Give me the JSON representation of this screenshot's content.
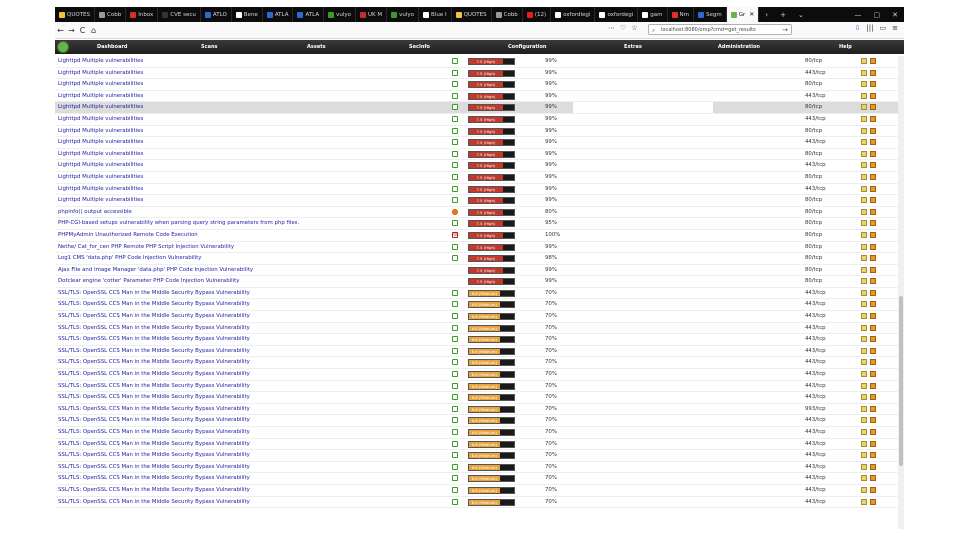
{
  "browser": {
    "tabs": [
      {
        "label": "QUOTES",
        "icon": "quote-icon",
        "color": "#f0c040"
      },
      {
        "label": "Cobb",
        "icon": "loading-icon",
        "color": "#999999"
      },
      {
        "label": "Inbox",
        "icon": "mail-icon",
        "color": "#d93025"
      },
      {
        "label": "CVE secu",
        "icon": "cve-icon",
        "color": "#333333"
      },
      {
        "label": "ATLO",
        "icon": "atl-icon",
        "color": "#2a6bd1"
      },
      {
        "label": "Bene",
        "icon": "doc-icon",
        "color": "#ffffff"
      },
      {
        "label": "ATLA",
        "icon": "atl-icon",
        "color": "#2a6bd1"
      },
      {
        "label": "ATLA",
        "icon": "atl-icon",
        "color": "#2a6bd1"
      },
      {
        "label": "vulyo",
        "icon": "globe-icon",
        "color": "#3a9a2a"
      },
      {
        "label": "UK M",
        "icon": "globe-icon",
        "color": "#c03030"
      },
      {
        "label": "vulyo",
        "icon": "globe-icon",
        "color": "#3a9a2a"
      },
      {
        "label": "Blue I",
        "icon": "shield-icon",
        "color": "#ffffff"
      },
      {
        "label": "QUOTES",
        "icon": "quote-icon",
        "color": "#f0c040"
      },
      {
        "label": "Cobb",
        "icon": "loading-icon",
        "color": "#999999"
      },
      {
        "label": "(12)",
        "icon": "video-icon",
        "color": "#e02020"
      },
      {
        "label": "oxfordlegi",
        "icon": "doc-icon",
        "color": "#ffffff"
      },
      {
        "label": "oxfordegi",
        "icon": "doc-icon",
        "color": "#ffffff"
      },
      {
        "label": "gam",
        "icon": "g-icon",
        "color": "#ffffff"
      },
      {
        "label": "Nm",
        "icon": "news-icon",
        "color": "#e03030"
      },
      {
        "label": "Segm",
        "icon": "s-icon",
        "color": "#2a6bd1"
      },
      {
        "label": "Gr",
        "icon": "leaf-icon",
        "color": "#6ab04c"
      }
    ],
    "url": "localhost:8080/omp?cmd=get_results",
    "window_controls": [
      "—",
      "▢",
      "✕"
    ],
    "nav": {
      "back": "←",
      "forward": "→",
      "reload": "C",
      "home": "⌂"
    },
    "toolbar_icons": [
      "⋯",
      "♡",
      "☆"
    ],
    "right_icons": [
      "⇩",
      "|||",
      "▭",
      "≡"
    ]
  },
  "app_nav": {
    "menus": [
      "Dashboard",
      "Scans",
      "Assets",
      "SecInfo",
      "Configuration",
      "Extras",
      "Administration",
      "Help"
    ]
  },
  "colors": {
    "high": "#c0392b",
    "medium": "#e8a33c",
    "link": "#1a1aa6"
  },
  "results": [
    {
      "name": "Lighttpd Multiple vulnerabilities",
      "status": "green",
      "severity": "7.5 (High)",
      "level": "high",
      "qod": "99%",
      "port": "80/tcp",
      "hl": false
    },
    {
      "name": "Lighttpd Multiple vulnerabilities",
      "status": "green",
      "severity": "7.5 (High)",
      "level": "high",
      "qod": "99%",
      "port": "443/tcp",
      "hl": false
    },
    {
      "name": "Lighttpd Multiple vulnerabilities",
      "status": "green",
      "severity": "7.5 (High)",
      "level": "high",
      "qod": "99%",
      "port": "80/tcp",
      "hl": false
    },
    {
      "name": "Lighttpd Multiple vulnerabilities",
      "status": "green",
      "severity": "7.5 (High)",
      "level": "high",
      "qod": "99%",
      "port": "443/tcp",
      "hl": false
    },
    {
      "name": "Lighttpd Multiple vulnerabilities",
      "status": "green",
      "severity": "7.5 (High)",
      "level": "high",
      "qod": "99%",
      "port": "80/tcp",
      "hl": true
    },
    {
      "name": "Lighttpd Multiple vulnerabilities",
      "status": "green",
      "severity": "7.5 (High)",
      "level": "high",
      "qod": "99%",
      "port": "443/tcp",
      "hl": false
    },
    {
      "name": "Lighttpd Multiple vulnerabilities",
      "status": "green",
      "severity": "7.5 (High)",
      "level": "high",
      "qod": "99%",
      "port": "80/tcp",
      "hl": false
    },
    {
      "name": "Lighttpd Multiple vulnerabilities",
      "status": "green",
      "severity": "7.5 (High)",
      "level": "high",
      "qod": "99%",
      "port": "443/tcp",
      "hl": false
    },
    {
      "name": "Lighttpd Multiple vulnerabilities",
      "status": "green",
      "severity": "7.5 (High)",
      "level": "high",
      "qod": "99%",
      "port": "80/tcp",
      "hl": false
    },
    {
      "name": "Lighttpd Multiple vulnerabilities",
      "status": "green",
      "severity": "7.5 (High)",
      "level": "high",
      "qod": "99%",
      "port": "443/tcp",
      "hl": false
    },
    {
      "name": "Lighttpd Multiple vulnerabilities",
      "status": "green",
      "severity": "7.5 (High)",
      "level": "high",
      "qod": "99%",
      "port": "80/tcp",
      "hl": false
    },
    {
      "name": "Lighttpd Multiple vulnerabilities",
      "status": "green",
      "severity": "7.5 (High)",
      "level": "high",
      "qod": "99%",
      "port": "443/tcp",
      "hl": false
    },
    {
      "name": "Lighttpd Multiple vulnerabilities",
      "status": "green",
      "severity": "7.5 (High)",
      "level": "high",
      "qod": "99%",
      "port": "80/tcp",
      "hl": false
    },
    {
      "name": "phpinfo() output accessible",
      "status": "orange",
      "severity": "7.5 (High)",
      "level": "high",
      "qod": "80%",
      "port": "80/tcp",
      "hl": false
    },
    {
      "name": "PHP-CGI-based setups vulnerability when parsing query string parameters from php files.",
      "status": "green",
      "severity": "7.5 (High)",
      "level": "high",
      "qod": "95%",
      "port": "80/tcp",
      "hl": false
    },
    {
      "name": "PHPMyAdmin Unauthorized Remote Code Execution",
      "status": "red",
      "severity": "7.5 (High)",
      "level": "high",
      "qod": "100%",
      "port": "80/tcp",
      "hl": false
    },
    {
      "name": "Nethe/ Cat_for_cen PHP Remote PHP Script Injection Vulnerability",
      "status": "green",
      "severity": "7.5 (High)",
      "level": "high",
      "qod": "99%",
      "port": "80/tcp",
      "hl": false
    },
    {
      "name": "Log1 CMS 'data.php' PHP Code Injection Vulnerability",
      "status": "green",
      "severity": "7.5 (High)",
      "level": "high",
      "qod": "98%",
      "port": "80/tcp",
      "hl": false
    },
    {
      "name": "Ajax File and Image Manager 'data.php' PHP Code Injection Vulnerability",
      "status": "none",
      "severity": "7.5 (High)",
      "level": "high",
      "qod": "99%",
      "port": "80/tcp",
      "hl": false
    },
    {
      "name": "Dotclear engine 'cotter' Parameter PHP Code Injection Vulnerability",
      "status": "none",
      "severity": "7.5 (High)",
      "level": "high",
      "qod": "99%",
      "port": "80/tcp",
      "hl": false
    },
    {
      "name": "SSL/TLS: OpenSSL CCS Man in the Middle Security Bypass Vulnerability",
      "status": "green",
      "severity": "6.8 (Medium)",
      "level": "medium",
      "qod": "70%",
      "port": "443/tcp",
      "hl": false
    },
    {
      "name": "SSL/TLS: OpenSSL CCS Man in the Middle Security Bypass Vulnerability",
      "status": "green",
      "severity": "6.8 (Medium)",
      "level": "medium",
      "qod": "70%",
      "port": "443/tcp",
      "hl": false
    },
    {
      "name": "SSL/TLS: OpenSSL CCS Man in the Middle Security Bypass Vulnerability",
      "status": "green",
      "severity": "6.8 (Medium)",
      "level": "medium",
      "qod": "70%",
      "port": "443/tcp",
      "hl": false
    },
    {
      "name": "SSL/TLS: OpenSSL CCS Man in the Middle Security Bypass Vulnerability",
      "status": "green",
      "severity": "6.8 (Medium)",
      "level": "medium",
      "qod": "70%",
      "port": "443/tcp",
      "hl": false
    },
    {
      "name": "SSL/TLS: OpenSSL CCS Man in the Middle Security Bypass Vulnerability",
      "status": "green",
      "severity": "6.8 (Medium)",
      "level": "medium",
      "qod": "70%",
      "port": "443/tcp",
      "hl": false
    },
    {
      "name": "SSL/TLS: OpenSSL CCS Man in the Middle Security Bypass Vulnerability",
      "status": "green",
      "severity": "6.8 (Medium)",
      "level": "medium",
      "qod": "70%",
      "port": "443/tcp",
      "hl": false
    },
    {
      "name": "SSL/TLS: OpenSSL CCS Man in the Middle Security Bypass Vulnerability",
      "status": "green",
      "severity": "6.8 (Medium)",
      "level": "medium",
      "qod": "70%",
      "port": "443/tcp",
      "hl": false
    },
    {
      "name": "SSL/TLS: OpenSSL CCS Man in the Middle Security Bypass Vulnerability",
      "status": "green",
      "severity": "6.8 (Medium)",
      "level": "medium",
      "qod": "70%",
      "port": "443/tcp",
      "hl": false
    },
    {
      "name": "SSL/TLS: OpenSSL CCS Man in the Middle Security Bypass Vulnerability",
      "status": "green",
      "severity": "6.8 (Medium)",
      "level": "medium",
      "qod": "70%",
      "port": "443/tcp",
      "hl": false
    },
    {
      "name": "SSL/TLS: OpenSSL CCS Man in the Middle Security Bypass Vulnerability",
      "status": "green",
      "severity": "6.8 (Medium)",
      "level": "medium",
      "qod": "70%",
      "port": "443/tcp",
      "hl": false
    },
    {
      "name": "SSL/TLS: OpenSSL CCS Man in the Middle Security Bypass Vulnerability",
      "status": "green",
      "severity": "6.8 (Medium)",
      "level": "medium",
      "qod": "70%",
      "port": "993/tcp",
      "hl": false
    },
    {
      "name": "SSL/TLS: OpenSSL CCS Man in the Middle Security Bypass Vulnerability",
      "status": "green",
      "severity": "6.8 (Medium)",
      "level": "medium",
      "qod": "70%",
      "port": "443/tcp",
      "hl": false
    },
    {
      "name": "SSL/TLS: OpenSSL CCS Man in the Middle Security Bypass Vulnerability",
      "status": "green",
      "severity": "6.8 (Medium)",
      "level": "medium",
      "qod": "70%",
      "port": "443/tcp",
      "hl": false
    },
    {
      "name": "SSL/TLS: OpenSSL CCS Man in the Middle Security Bypass Vulnerability",
      "status": "green",
      "severity": "6.8 (Medium)",
      "level": "medium",
      "qod": "70%",
      "port": "443/tcp",
      "hl": false
    },
    {
      "name": "SSL/TLS: OpenSSL CCS Man in the Middle Security Bypass Vulnerability",
      "status": "green",
      "severity": "6.8 (Medium)",
      "level": "medium",
      "qod": "70%",
      "port": "443/tcp",
      "hl": false
    },
    {
      "name": "SSL/TLS: OpenSSL CCS Man in the Middle Security Bypass Vulnerability",
      "status": "green",
      "severity": "6.8 (Medium)",
      "level": "medium",
      "qod": "70%",
      "port": "443/tcp",
      "hl": false
    },
    {
      "name": "SSL/TLS: OpenSSL CCS Man in the Middle Security Bypass Vulnerability",
      "status": "green",
      "severity": "6.8 (Medium)",
      "level": "medium",
      "qod": "70%",
      "port": "443/tcp",
      "hl": false
    },
    {
      "name": "SSL/TLS: OpenSSL CCS Man in the Middle Security Bypass Vulnerability",
      "status": "green",
      "severity": "6.8 (Medium)",
      "level": "medium",
      "qod": "70%",
      "port": "443/tcp",
      "hl": false
    },
    {
      "name": "SSL/TLS: OpenSSL CCS Man in the Middle Security Bypass Vulnerability",
      "status": "green",
      "severity": "6.8 (Medium)",
      "level": "medium",
      "qod": "70%",
      "port": "443/tcp",
      "hl": false
    }
  ]
}
